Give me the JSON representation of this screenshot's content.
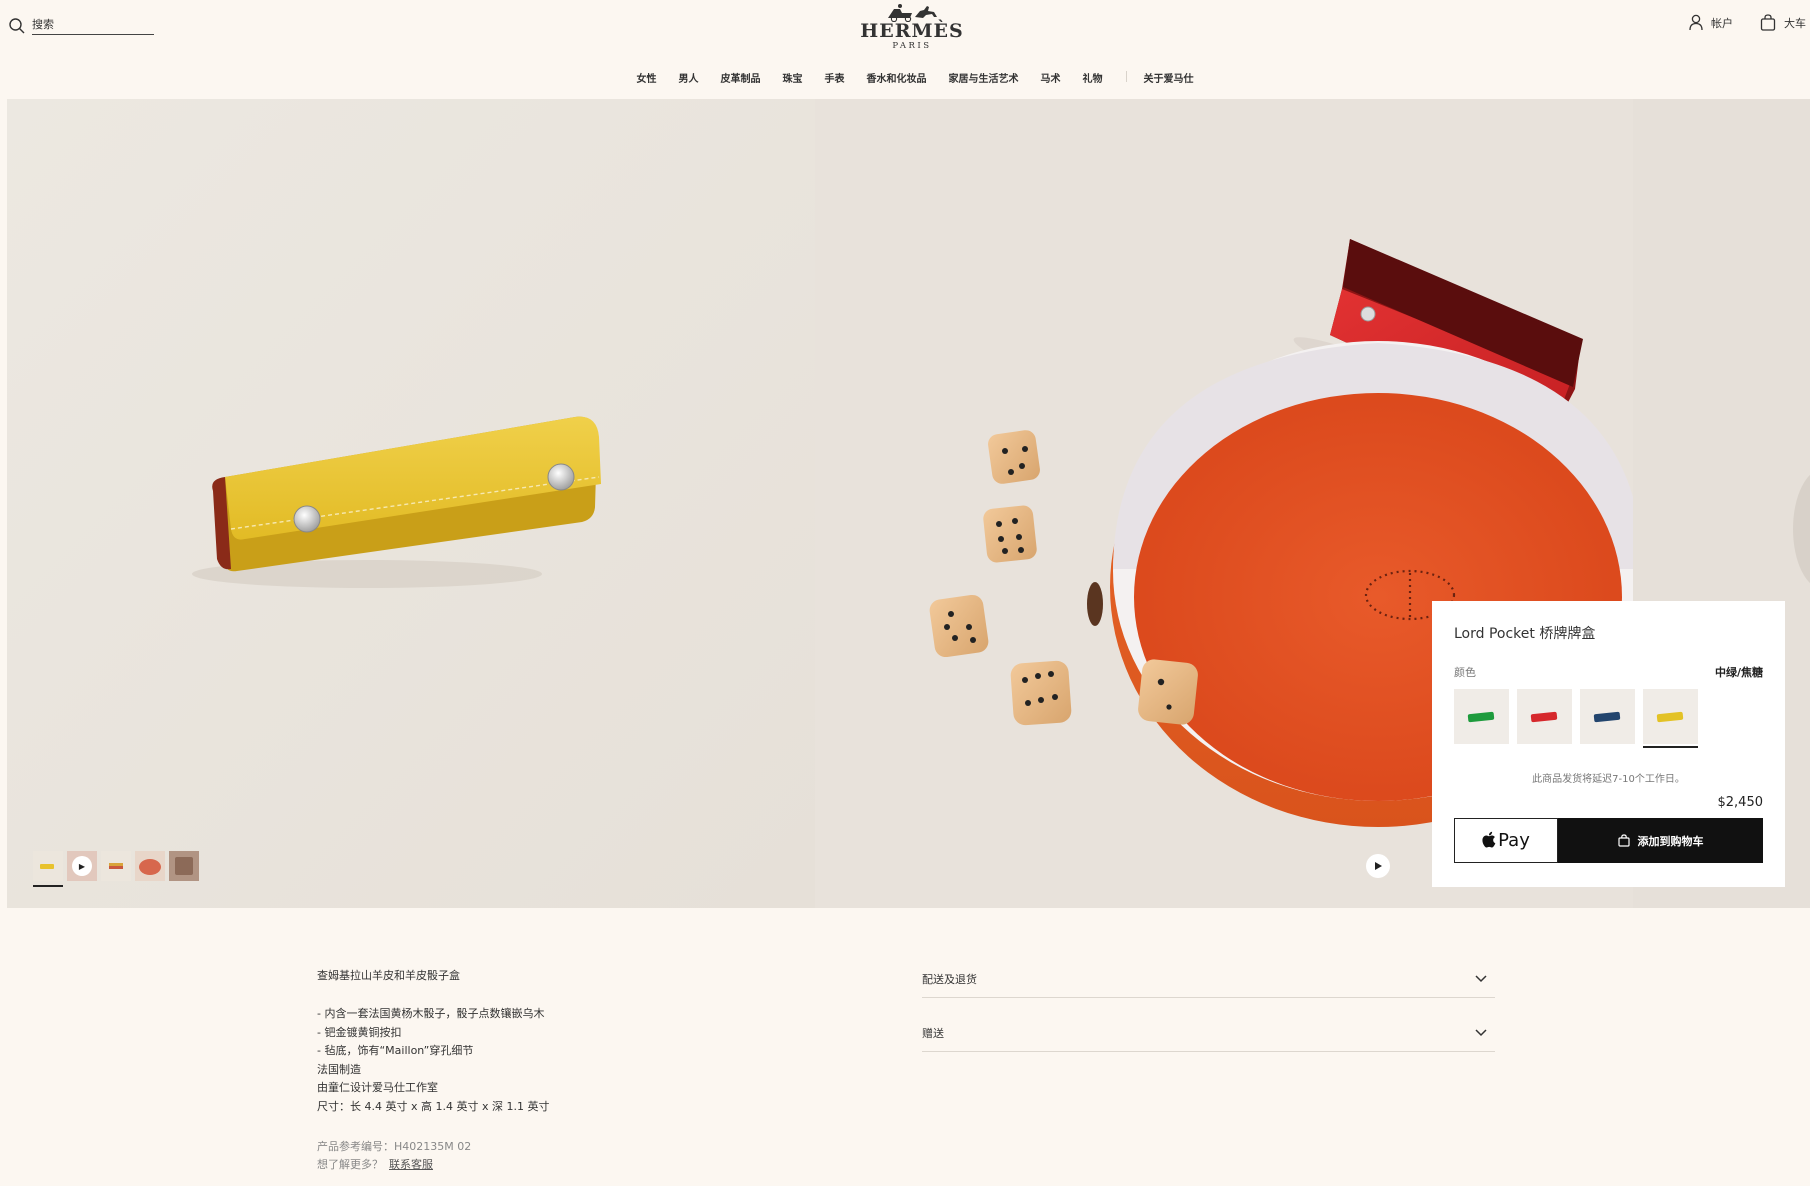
{
  "header": {
    "search_placeholder": "搜索",
    "brand_name": "HERMÈS",
    "brand_city": "PARIS",
    "account_label": "帐户",
    "cart_label": "大车"
  },
  "nav": {
    "items": [
      "女性",
      "男人",
      "皮革制品",
      "珠宝",
      "手表",
      "香水和化妆品",
      "家居与生活艺术",
      "马术",
      "礼物"
    ],
    "about": "关于爱马仕"
  },
  "gallery": {
    "thumbnails": [
      "yellow-case",
      "video",
      "multi-color",
      "dice-tray",
      "photo"
    ],
    "active_thumbnail": 0,
    "colors": {
      "yellow_case": "#e8c32f",
      "tray_orange": "#e5531f",
      "red_case": "#d62a2a"
    }
  },
  "product": {
    "title": "Lord Pocket 桥牌牌盒",
    "color_label": "颜色",
    "color_value": "中绿/焦糖",
    "swatches": [
      "green",
      "red",
      "navy",
      "yellow"
    ],
    "selected_swatch": "yellow",
    "shipping_note": "此商品发货将延迟7-10个工作日。",
    "price": "$2,450",
    "apple_pay_label": "Pay",
    "add_to_cart_label": "添加到购物车"
  },
  "details": {
    "title": "查姆基拉山羊皮和羊皮骰子盒",
    "lines": [
      "- 内含一套法国黄杨木骰子，骰子点数镶嵌乌木",
      "- 钯金镀黄铜按扣",
      "- 毡底，饰有“Maillon”穿孔细节",
      "法国制造",
      " 由童仁设计爱马仕工作室",
      "尺寸：长 4.4 英寸 x 高 1.4 英寸 x 深 1.1 英寸"
    ],
    "reference": "产品参考编号：H402135M 02",
    "help_text": "想了解更多？",
    "contact_link": "联系客服"
  },
  "accordion": {
    "shipping": "配送及退货",
    "gift": "赠送"
  }
}
